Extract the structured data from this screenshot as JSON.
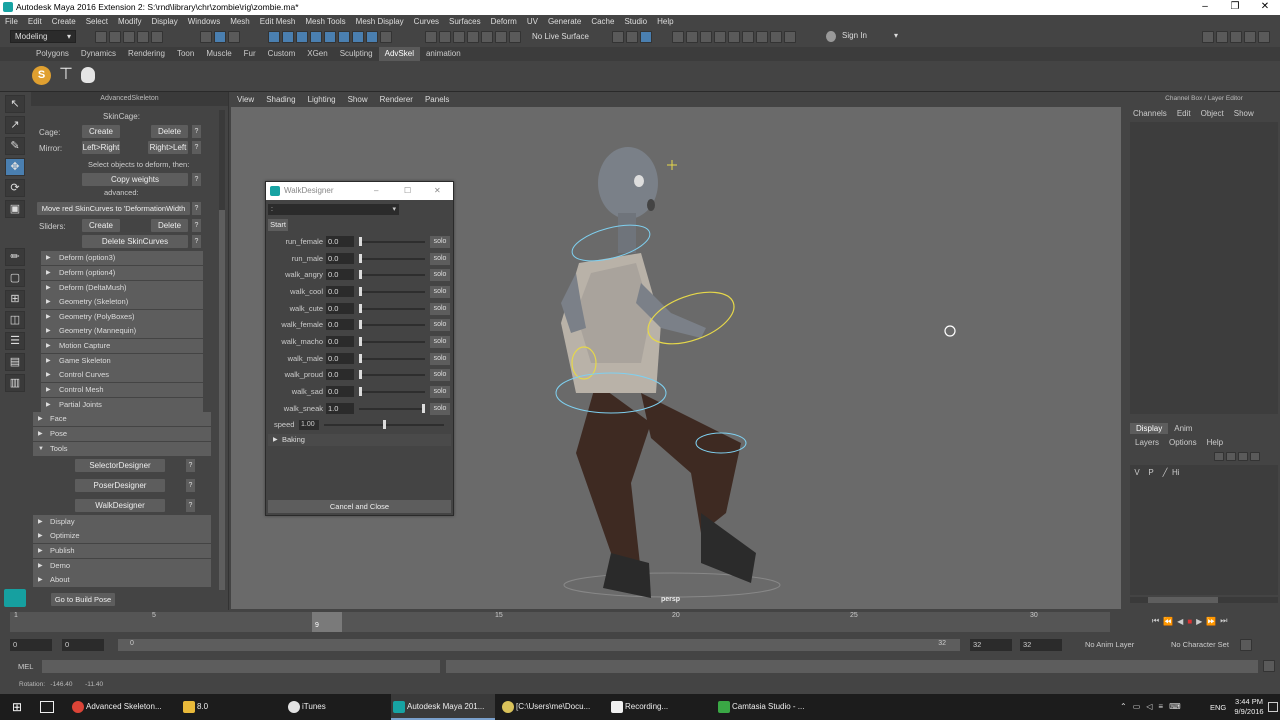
{
  "window": {
    "title": "Autodesk Maya 2016 Extension 2: S:\\rnd\\library\\chr\\zombie\\rig\\zombie.ma*"
  },
  "menubar": [
    "File",
    "Edit",
    "Create",
    "Select",
    "Modify",
    "Display",
    "Windows",
    "Mesh",
    "Edit Mesh",
    "Mesh Tools",
    "Mesh Display",
    "Curves",
    "Surfaces",
    "Deform",
    "UV",
    "Generate",
    "Cache",
    "Studio",
    "Help"
  ],
  "statusline": {
    "mode": "Modeling",
    "live_surface": "No Live Surface",
    "sign_in": "Sign In"
  },
  "shelf_tabs": [
    "Polygons",
    "Dynamics",
    "Rendering",
    "Toon",
    "Muscle",
    "Fur",
    "Custom",
    "XGen",
    "Sculpting",
    "AdvSkel",
    "animation"
  ],
  "shelf_active": "AdvSkel",
  "as_panel": {
    "header": "AdvancedSkeleton",
    "skincage": "SkinCage:",
    "cage_label": "Cage:",
    "create": "Create",
    "delete": "Delete",
    "q": "?",
    "mirror_label": "Mirror:",
    "left_right": "Left>Right",
    "right_left": "Right>Left",
    "select_deform": "Select objects to deform, then:",
    "copy_weights": "Copy weights",
    "advanced": "advanced:",
    "move_red": "Move red SkinCurves to 'DeformationWidth",
    "sliders_label": "Sliders:",
    "delete_skincurves": "Delete SkinCurves",
    "folds": [
      "Deform      (option3)",
      "Deform      (option4)",
      "Deform      (DeltaMush)",
      "Geometry (Skeleton)",
      "Geometry (PolyBoxes)",
      "Geometry (Mannequin)",
      "Motion Capture",
      "Game Skeleton",
      "Control Curves",
      "Control Mesh",
      "Partial Joints"
    ],
    "sections_top": [
      "Face",
      "Pose"
    ],
    "tools": "Tools",
    "tool_buttons": [
      "SelectorDesigner",
      "PoserDesigner",
      "WalkDesigner"
    ],
    "sections_bottom": [
      "Display",
      "Optimize",
      "Publish",
      "Demo",
      "About"
    ],
    "build_pose": "Go to Build Pose"
  },
  "viewport": {
    "menu": [
      "View",
      "Shading",
      "Lighting",
      "Show",
      "Renderer",
      "Panels"
    ],
    "camera": "persp"
  },
  "walk_designer": {
    "title": "WalkDesigner",
    "dropdown": ":",
    "start": "Start",
    "rows": [
      {
        "label": "run_female",
        "value": "0.0",
        "level": 0.0
      },
      {
        "label": "run_male",
        "value": "0.0",
        "level": 0.0
      },
      {
        "label": "walk_angry",
        "value": "0.0",
        "level": 0.0
      },
      {
        "label": "walk_cool",
        "value": "0.0",
        "level": 0.0
      },
      {
        "label": "walk_cute",
        "value": "0.0",
        "level": 0.0
      },
      {
        "label": "walk_female",
        "value": "0.0",
        "level": 0.0
      },
      {
        "label": "walk_macho",
        "value": "0.0",
        "level": 0.0
      },
      {
        "label": "walk_male",
        "value": "0.0",
        "level": 0.0
      },
      {
        "label": "walk_proud",
        "value": "0.0",
        "level": 0.0
      },
      {
        "label": "walk_sad",
        "value": "0.0",
        "level": 0.0
      },
      {
        "label": "walk_sneak",
        "value": "1.0",
        "level": 1.0
      }
    ],
    "solo": "solo",
    "speed_label": "speed",
    "speed_value": "1.00",
    "speed_level": 0.5,
    "baking": "Baking",
    "cancel": "Cancel and Close"
  },
  "channel_box": {
    "title": "Channel Box / Layer Editor",
    "menu": [
      "Channels",
      "Edit",
      "Object",
      "Show"
    ],
    "tabs": [
      "Display",
      "Anim"
    ],
    "layer_menu": [
      "Layers",
      "Options",
      "Help"
    ],
    "layer": {
      "v": "V",
      "p": "P",
      "name": "Hi"
    }
  },
  "timeline": {
    "ticks": [
      "1",
      "5",
      "10",
      "15",
      "20",
      "25",
      "30"
    ],
    "current": "9"
  },
  "range": {
    "start": "0",
    "start2": "0",
    "bar_start": "0",
    "bar_end": "32",
    "end": "32",
    "end2": "32",
    "anim_layer": "No Anim Layer",
    "char_set": "No Character Set"
  },
  "cmdline": {
    "label": "MEL"
  },
  "helpline": {
    "text": "Rotation:   -146.40       -11.40"
  },
  "taskbar": {
    "items": [
      "Advanced Skeleton...",
      "8.0",
      "iTunes",
      "Autodesk Maya 201...",
      "[C:\\Users\\me\\Docu...",
      "Recording...",
      "Camtasia Studio - ..."
    ],
    "lang": "ENG",
    "time": "3:44 PM",
    "date": "9/9/2016"
  }
}
